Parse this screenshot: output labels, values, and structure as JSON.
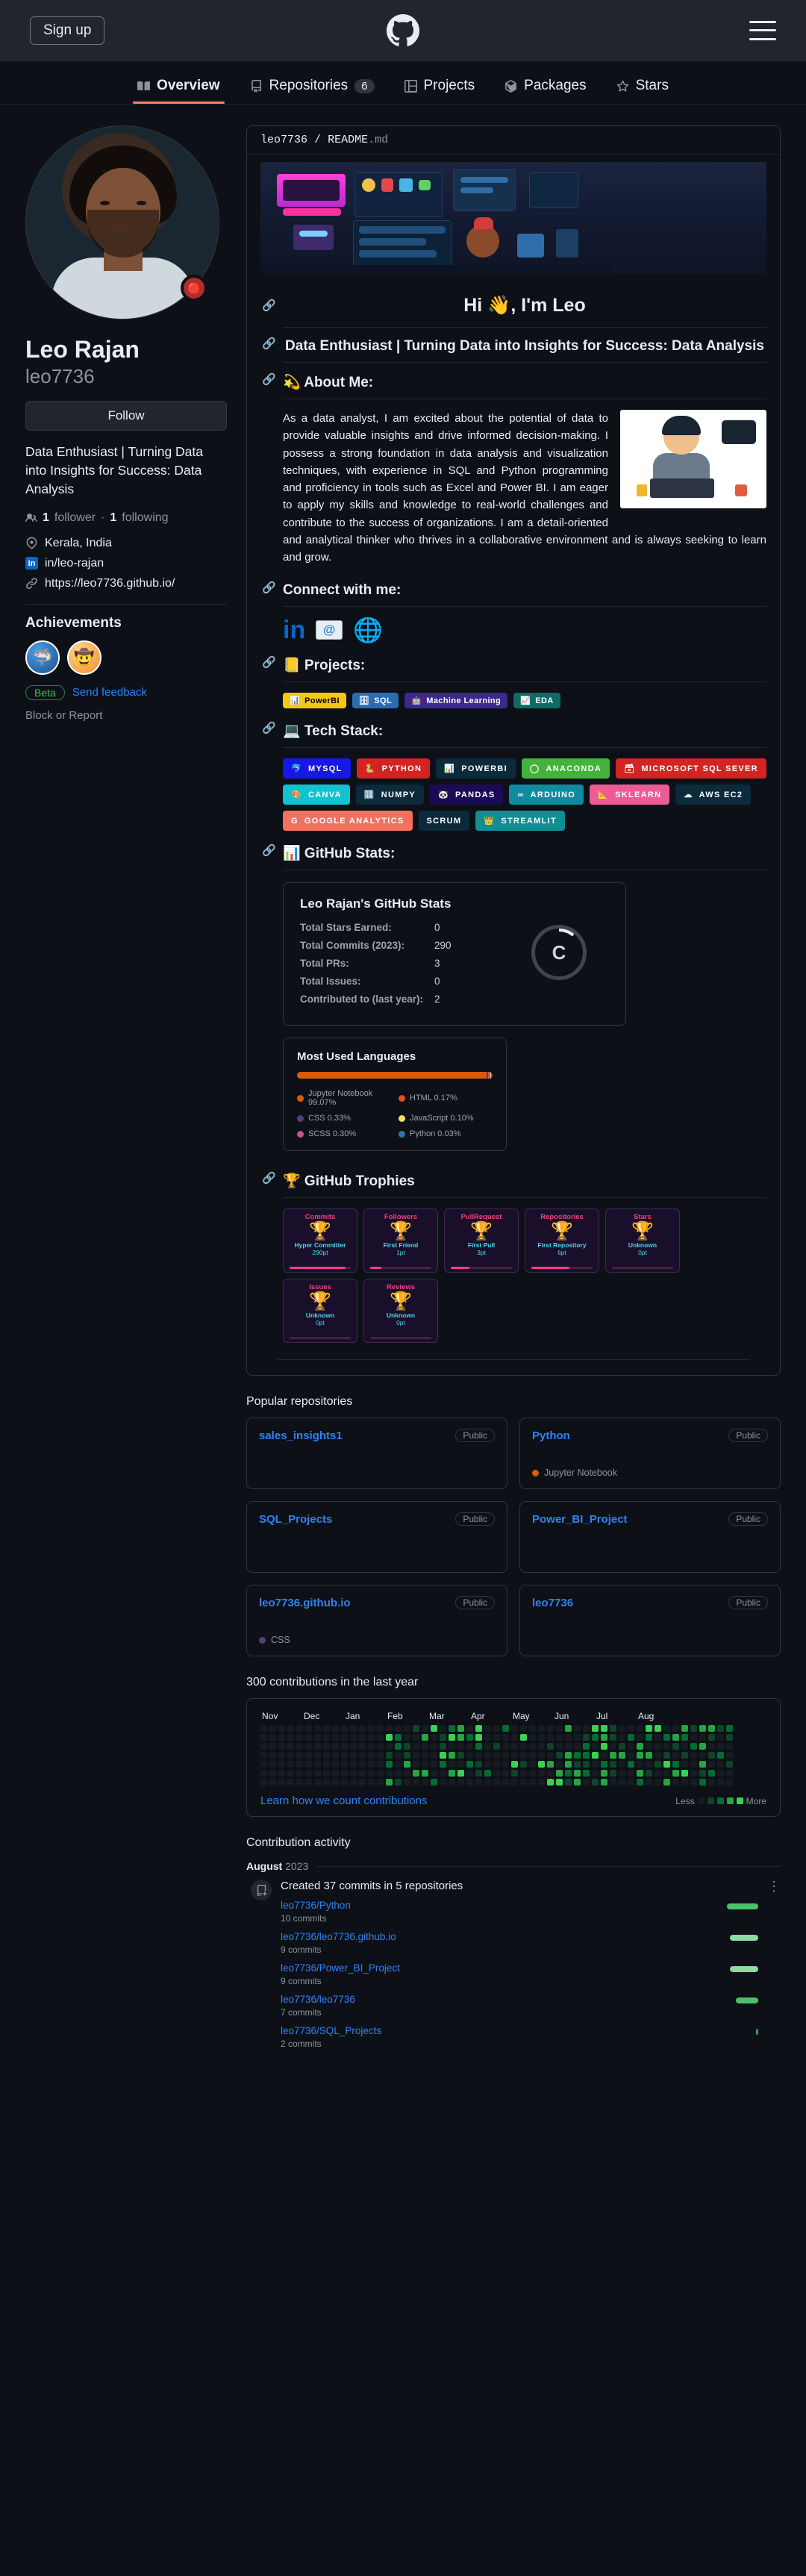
{
  "topbar": {
    "signup_label": "Sign up",
    "logo_icon": "github-mark-icon",
    "menu_icon": "hamburger-menu-icon"
  },
  "nav": {
    "tabs": [
      {
        "label": "Overview",
        "icon": "book-icon",
        "count": null,
        "active": true
      },
      {
        "label": "Repositories",
        "icon": "repo-icon",
        "count": "6",
        "active": false
      },
      {
        "label": "Projects",
        "icon": "project-table-icon",
        "count": null,
        "active": false
      },
      {
        "label": "Packages",
        "icon": "package-icon",
        "count": null,
        "active": false
      },
      {
        "label": "Stars",
        "icon": "star-icon",
        "count": null,
        "active": false
      }
    ]
  },
  "profile": {
    "avatar_alt": "Leo Rajan avatar",
    "status_emoji": "🔴",
    "fullname": "Leo Rajan",
    "username": "leo7736",
    "follow_label": "Follow",
    "bio": "Data Enthusiast | Turning Data into Insights for Success: Data Analysis",
    "followers_count": "1",
    "followers_label": "follower",
    "separator": "·",
    "following_count": "1",
    "following_label": "following",
    "location": "Kerala, India",
    "linkedin": "in/leo-rajan",
    "website": "https://leo7736.github.io/",
    "achievements_title": "Achievements",
    "achievement_items": [
      {
        "name": "pull-shark",
        "emoji": "🦈"
      },
      {
        "name": "quickdraw",
        "emoji": "🤠"
      }
    ],
    "beta_label": "Beta",
    "feedback_label": "Send feedback",
    "block_report_label": "Block or Report"
  },
  "readme": {
    "owner": "leo7736",
    "slash": "/",
    "file": "README",
    "ext": ".md",
    "banner_alt": "pixel art gaming room banner",
    "title": "Hi 👋, I'm Leo",
    "subtitle": "Data Enthusiast | Turning Data into Insights for Success: Data Analysis",
    "about_heading": "💫 About Me:",
    "about_text": "As a data analyst, I am excited about the potential of data to provide valuable insights and drive informed decision-making. I possess a strong foundation in data analysis and visualization techniques, with experience in SQL and Python programming and proficiency in tools such as Excel and Power BI. I am eager to apply my skills and knowledge to real-world challenges and contribute to the success of organizations. I am a detail-oriented and analytical thinker who thrives in a collaborative environment and is always seeking to learn and grow.",
    "connect_heading": "Connect with me:",
    "social_icons": [
      {
        "name": "linkedin-icon",
        "glyph": "in"
      },
      {
        "name": "email-icon",
        "glyph": "@"
      },
      {
        "name": "website-globe-icon",
        "glyph": "🌐"
      }
    ],
    "projects_heading": "📒 Projects:",
    "project_chips": [
      {
        "label": "PowerBI",
        "icon": "📊",
        "bg": "#F2C811",
        "fg": "#000000"
      },
      {
        "label": "SQL",
        "icon": "🗄",
        "bg": "#2b6cb0",
        "fg": "#ffffff"
      },
      {
        "label": "Machine Learning",
        "icon": "🤖",
        "bg": "#3b2a8c",
        "fg": "#ffffff"
      },
      {
        "label": "EDA",
        "icon": "📈",
        "bg": "#0f6b63",
        "fg": "#ffffff"
      }
    ],
    "tech_heading": "💻 Tech Stack:",
    "tech_chips": [
      {
        "label": "MYSQL",
        "icon": "🐬",
        "bg": "#1717e6"
      },
      {
        "label": "PYTHON",
        "icon": "🐍",
        "bg": "#d32323"
      },
      {
        "label": "POWERBI",
        "icon": "📊",
        "bg": "#0b2b3c"
      },
      {
        "label": "ANACONDA",
        "icon": "◯",
        "bg": "#44b33c"
      },
      {
        "label": "MICROSOFT SQL SEVER",
        "icon": "🗃",
        "bg": "#d32323"
      },
      {
        "label": "CANVA",
        "icon": "🎨",
        "bg": "#12c2cf"
      },
      {
        "label": "NUMPY",
        "icon": "🔢",
        "bg": "#0b2b3c"
      },
      {
        "label": "PANDAS",
        "icon": "🐼",
        "bg": "#1b0b57"
      },
      {
        "label": "ARDUINO",
        "icon": "∞",
        "bg": "#0f8ba0"
      },
      {
        "label": "SKLEARN",
        "icon": "📐",
        "bg": "#ed5b96"
      },
      {
        "label": "AWS EC2",
        "icon": "☁",
        "bg": "#0b2b3c"
      },
      {
        "label": "GOOGLE ANALYTICS",
        "icon": "G",
        "bg": "#f4705f"
      },
      {
        "label": "SCRUM",
        "icon": "",
        "bg": "#0b2b3c"
      },
      {
        "label": "STREAMLIT",
        "icon": "👑",
        "bg": "#0f8e94"
      }
    ],
    "stats_heading": "📊 GitHub Stats:",
    "stats_card": {
      "title": "Leo Rajan's GitHub Stats",
      "rows": [
        {
          "label": "Total Stars Earned:",
          "value": "0"
        },
        {
          "label": "Total Commits (2023):",
          "value": "290"
        },
        {
          "label": "Total PRs:",
          "value": "3"
        },
        {
          "label": "Total Issues:",
          "value": "0"
        },
        {
          "label": "Contributed to (last year):",
          "value": "2"
        }
      ],
      "rank": "C"
    },
    "languages_card": {
      "title": "Most Used Languages",
      "items": [
        {
          "label": "Jupyter Notebook 99.07%",
          "color": "#DA5B0B",
          "pct": 99.07
        },
        {
          "label": "HTML 0.17%",
          "color": "#e34c26",
          "pct": 0.17
        },
        {
          "label": "CSS 0.33%",
          "color": "#563d7c",
          "pct": 0.33
        },
        {
          "label": "JavaScript 0.10%",
          "color": "#f1e05a",
          "pct": 0.1
        },
        {
          "label": "SCSS 0.30%",
          "color": "#c6538c",
          "pct": 0.3
        },
        {
          "label": "Python 0.03%",
          "color": "#3572A5",
          "pct": 0.03
        }
      ]
    },
    "trophies_heading": "🏆 GitHub Trophies",
    "trophies": [
      {
        "title": "Commits",
        "cup": "🏆",
        "name": "Hyper Committer",
        "points": "290pt",
        "fill": 92,
        "gold": true
      },
      {
        "title": "Followers",
        "cup": "🏆",
        "name": "First Friend",
        "points": "1pt",
        "fill": 18,
        "gold": false
      },
      {
        "title": "PullRequest",
        "cup": "🏆",
        "name": "First Pull",
        "points": "3pt",
        "fill": 30,
        "gold": false
      },
      {
        "title": "Repositories",
        "cup": "🏆",
        "name": "First Repository",
        "points": "6pt",
        "fill": 62,
        "gold": false
      },
      {
        "title": "Stars",
        "cup": "🏆",
        "name": "Unknown",
        "points": "0pt",
        "fill": 0,
        "gold": false
      },
      {
        "title": "Issues",
        "cup": "🏆",
        "name": "Unknown",
        "points": "0pt",
        "fill": 0,
        "gold": false
      },
      {
        "title": "Reviews",
        "cup": "🏆",
        "name": "Unknown",
        "points": "0pt",
        "fill": 0,
        "gold": false
      }
    ]
  },
  "popular_repos": {
    "title": "Popular repositories",
    "items": [
      {
        "name": "sales_insights1",
        "visibility": "Public",
        "language": null,
        "language_color": null
      },
      {
        "name": "Python",
        "visibility": "Public",
        "language": "Jupyter Notebook",
        "language_color": "#DA5B0B"
      },
      {
        "name": "SQL_Projects",
        "visibility": "Public",
        "language": null,
        "language_color": null
      },
      {
        "name": "Power_BI_Project",
        "visibility": "Public",
        "language": null,
        "language_color": null
      },
      {
        "name": "leo7736.github.io",
        "visibility": "Public",
        "language": "CSS",
        "language_color": "#563d7c"
      },
      {
        "name": "leo7736",
        "visibility": "Public",
        "language": null,
        "language_color": null
      }
    ]
  },
  "contributions": {
    "title": "300 contributions in the last year",
    "months": [
      "Nov",
      "Dec",
      "Jan",
      "Feb",
      "Mar",
      "Apr",
      "May",
      "Jun",
      "Jul",
      "Aug"
    ],
    "learn_link": "Learn how we count contributions",
    "legend_less": "Less",
    "legend_more": "More"
  },
  "activity": {
    "title": "Contribution activity",
    "month": "August",
    "year": "2023",
    "summary": "Created 37 commits in 5 repositories",
    "kebab_icon": "kebab-vertical-icon",
    "items": [
      {
        "repo": "leo7736/Python",
        "commits": "10 commits",
        "bar_pct": 100,
        "bar_color": "#4ac26b"
      },
      {
        "repo": "leo7736/leo7736.github.io",
        "commits": "9 commits",
        "bar_pct": 90,
        "bar_color": "#8ddb9f"
      },
      {
        "repo": "leo7736/Power_BI_Project",
        "commits": "9 commits",
        "bar_pct": 90,
        "bar_color": "#8ddb9f"
      },
      {
        "repo": "leo7736/leo7736",
        "commits": "7 commits",
        "bar_pct": 72,
        "bar_color": "#4ac26b"
      },
      {
        "repo": "leo7736/SQL_Projects",
        "commits": "2 commits",
        "bar_pct": 8,
        "bar_color": "#2ea043"
      }
    ]
  },
  "chart_data": {
    "type": "bar",
    "title": "Most Used Languages",
    "categories": [
      "Jupyter Notebook",
      "CSS",
      "SCSS",
      "HTML",
      "JavaScript",
      "Python"
    ],
    "values": [
      99.07,
      0.33,
      0.3,
      0.17,
      0.1,
      0.03
    ],
    "ylabel": "percent",
    "ylim": [
      0,
      100
    ],
    "legend": "inline"
  }
}
